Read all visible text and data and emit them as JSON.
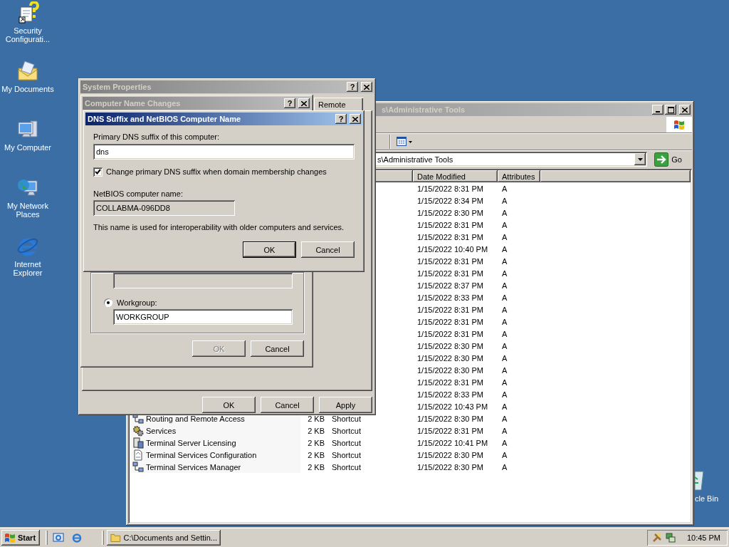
{
  "desktop_icons": [
    {
      "label": "Security Configurati...",
      "kind": "security"
    },
    {
      "label": "My Documents",
      "kind": "documents"
    },
    {
      "label": "My Computer",
      "kind": "computer"
    },
    {
      "label": "My Network Places",
      "kind": "network"
    },
    {
      "label": "Internet Explorer",
      "kind": "browser"
    }
  ],
  "recycle_bin_label": "cle Bin",
  "explorer": {
    "title": "s\\Administrative Tools",
    "active": false,
    "address": "s\\Administrative Tools",
    "go_label": "Go",
    "columns": [
      {
        "label": "Date Modified"
      },
      {
        "label": "Attributes"
      }
    ],
    "rows": [
      {
        "modified": "1/15/2022 8:31 PM",
        "attributes": "A"
      },
      {
        "modified": "1/15/2022 8:34 PM",
        "attributes": "A"
      },
      {
        "modified": "1/15/2022 8:30 PM",
        "attributes": "A"
      },
      {
        "modified": "1/15/2022 8:31 PM",
        "attributes": "A"
      },
      {
        "modified": "1/15/2022 8:31 PM",
        "attributes": "A"
      },
      {
        "modified": "1/15/2022 10:40 PM",
        "attributes": "A"
      },
      {
        "modified": "1/15/2022 8:31 PM",
        "attributes": "A"
      },
      {
        "modified": "1/15/2022 8:31 PM",
        "attributes": "A"
      },
      {
        "modified": "1/15/2022 8:37 PM",
        "attributes": "A"
      },
      {
        "modified": "1/15/2022 8:33 PM",
        "attributes": "A"
      },
      {
        "modified": "1/15/2022 8:31 PM",
        "attributes": "A"
      },
      {
        "modified": "1/15/2022 8:31 PM",
        "attributes": "A"
      },
      {
        "modified": "1/15/2022 8:31 PM",
        "attributes": "A"
      },
      {
        "modified": "1/15/2022 8:30 PM",
        "attributes": "A"
      },
      {
        "modified": "1/15/2022 8:30 PM",
        "attributes": "A"
      },
      {
        "modified": "1/15/2022 8:30 PM",
        "attributes": "A"
      },
      {
        "modified": "1/15/2022 8:31 PM",
        "attributes": "A"
      },
      {
        "modified": "1/15/2022 8:33 PM",
        "attributes": "A"
      },
      {
        "modified": "1/15/2022 10:43 PM",
        "attributes": "A"
      },
      {
        "name": "Routing and Remote Access",
        "kind": "network",
        "size": "2 KB",
        "type": "Shortcut",
        "modified": "1/15/2022 8:30 PM",
        "attributes": "A"
      },
      {
        "name": "Services",
        "kind": "gear",
        "size": "2 KB",
        "type": "Shortcut",
        "modified": "1/15/2022 8:31 PM",
        "attributes": "A"
      },
      {
        "name": "Terminal Server Licensing",
        "kind": "server",
        "size": "2 KB",
        "type": "Shortcut",
        "modified": "1/15/2022 10:41 PM",
        "attributes": "A"
      },
      {
        "name": "Terminal Services Configuration",
        "kind": "document",
        "size": "2 KB",
        "type": "Shortcut",
        "modified": "1/15/2022 8:30 PM",
        "attributes": "A"
      },
      {
        "name": "Terminal Services Manager",
        "kind": "network",
        "size": "2 KB",
        "type": "Shortcut",
        "modified": "1/15/2022 8:30 PM",
        "attributes": "A"
      }
    ]
  },
  "system_properties": {
    "title": "System Properties",
    "active": false,
    "help_button": "?",
    "tabs": [
      {
        "label": "Remote",
        "selected": false
      }
    ],
    "buttons": [
      {
        "label": "OK",
        "disabled": false
      },
      {
        "label": "Cancel",
        "disabled": false
      },
      {
        "label": "Apply",
        "disabled": false
      }
    ]
  },
  "computer_name_changes": {
    "title": "Computer Name Changes",
    "active": false,
    "help_button": "?",
    "workgroup": {
      "label": "Workgroup:",
      "selected": true,
      "value": "WORKGROUP"
    },
    "buttons": [
      {
        "label": "OK",
        "disabled": true
      },
      {
        "label": "Cancel",
        "disabled": false
      }
    ]
  },
  "dns_dialog": {
    "title": "DNS Suffix and NetBIOS Computer Name",
    "active": true,
    "help_button": "?",
    "suffix_label": "Primary DNS suffix of this computer:",
    "suffix_value": "dns",
    "checkbox": {
      "label": "Change primary DNS suffix when domain membership changes",
      "checked": true
    },
    "netbios_label": "NetBIOS computer name:",
    "netbios_value": "COLLABMA-096DD8",
    "note": "This name is used for interoperability with older computers and services.",
    "buttons": [
      {
        "label": "OK",
        "default": true
      },
      {
        "label": "Cancel",
        "default": false
      }
    ]
  },
  "taskbar": {
    "start_label": "Start",
    "tasks": [
      {
        "label": "C:\\Documents and Settin...",
        "selected": false
      }
    ],
    "clock": "10:45 PM"
  }
}
